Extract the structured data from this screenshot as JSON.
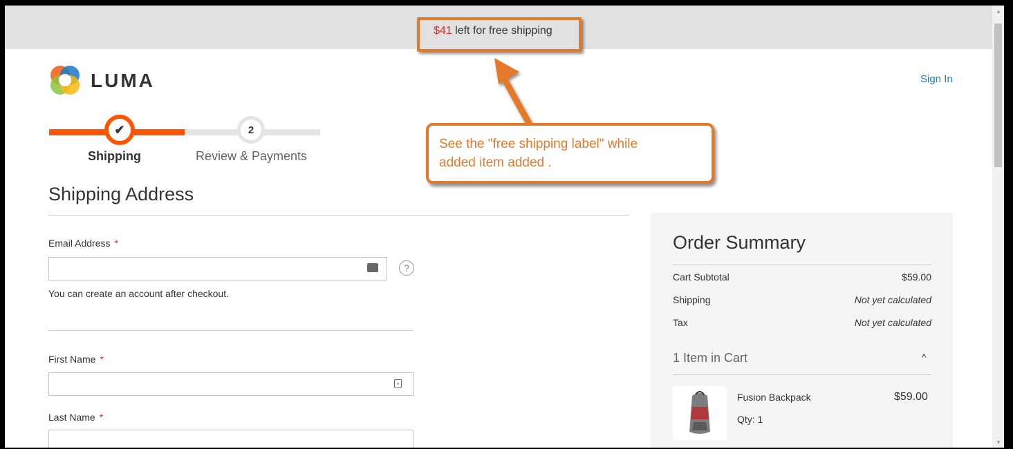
{
  "banner": {
    "amount": "$41",
    "text": " left for free shipping"
  },
  "header": {
    "logo_text": "LUMA",
    "sign_in": "Sign In"
  },
  "progress": {
    "steps": [
      {
        "number": "✔",
        "label": "Shipping",
        "state": "complete"
      },
      {
        "number": "2",
        "label": "Review & Payments",
        "state": "pending"
      }
    ]
  },
  "annotation": {
    "line1": "See the \"free shipping label\" while",
    "line2": "added item added ."
  },
  "shipping": {
    "title": "Shipping Address",
    "email_label": "Email Address",
    "email_value": "",
    "email_note": "You can create an account after checkout.",
    "help_icon": "?",
    "first_name_label": "First Name",
    "first_name_value": "",
    "last_name_label": "Last Name",
    "last_name_value": "",
    "required_mark": "*"
  },
  "summary": {
    "title": "Order Summary",
    "rows": [
      {
        "label": "Cart Subtotal",
        "value": "$59.00"
      },
      {
        "label": "Shipping",
        "value": "Not yet calculated"
      },
      {
        "label": "Tax",
        "value": "Not yet calculated"
      }
    ],
    "cart_count": "1 Item in Cart",
    "chevron": "^",
    "item": {
      "name": "Fusion Backpack",
      "qty": "Qty: 1",
      "price": "$59.00"
    }
  },
  "colors": {
    "accent": "#ff5501",
    "annotation": "#e27a2c",
    "link": "#1979c3",
    "price_red": "#e02b27"
  }
}
